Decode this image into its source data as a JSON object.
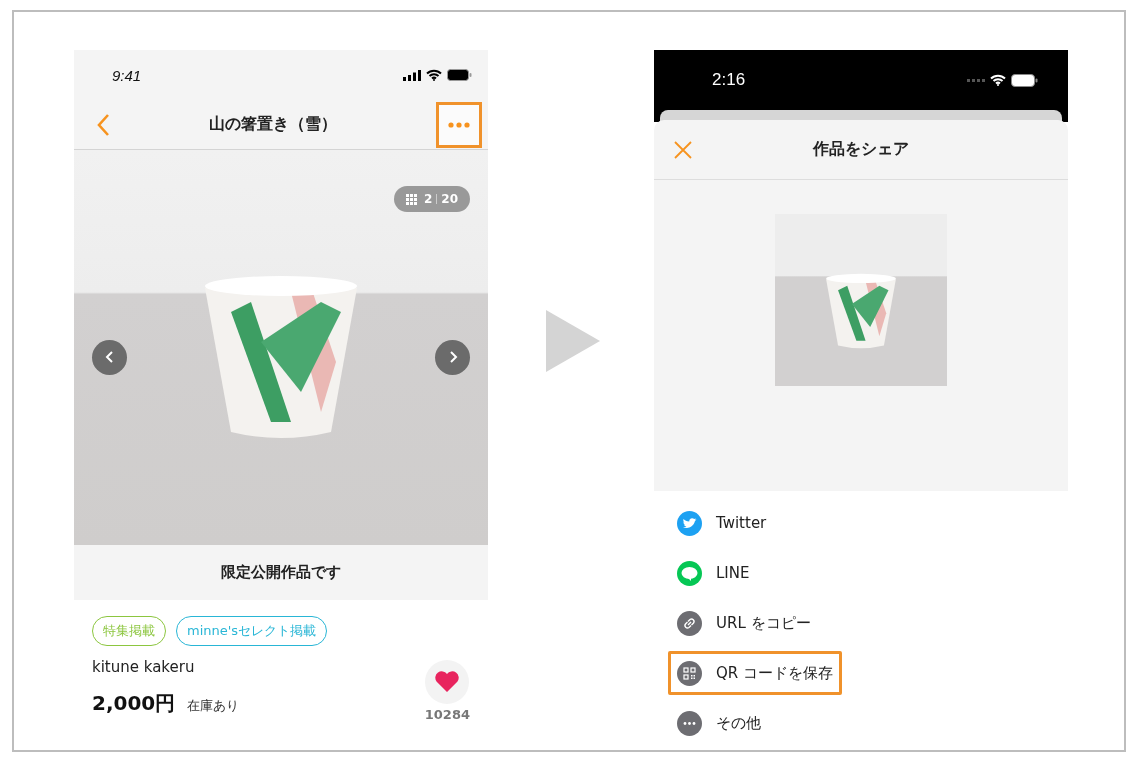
{
  "left_screen": {
    "status_bar": {
      "time": "9:41"
    },
    "nav": {
      "title": "山の箸置き（雪）",
      "more_highlighted": true
    },
    "photo": {
      "counter_current": "2",
      "counter_total": "20"
    },
    "notice": "限定公開作品です",
    "tags": [
      {
        "label": "特集掲載",
        "color": "#8cc63f"
      },
      {
        "label": "minne'sセレクト掲載",
        "color": "#29b6d6"
      }
    ],
    "creator": "kitune kakeru",
    "price": "2,000円",
    "stock": "在庫あり",
    "like_count": "10284"
  },
  "right_screen": {
    "status_bar": {
      "time": "2:16"
    },
    "sheet": {
      "title": "作品をシェア"
    },
    "share_items": [
      {
        "kind": "twitter",
        "label": "Twitter",
        "highlighted": false
      },
      {
        "kind": "line",
        "label": "LINE",
        "highlighted": false
      },
      {
        "kind": "link",
        "label": "URL をコピー",
        "highlighted": false
      },
      {
        "kind": "qr",
        "label": "QR コードを保存",
        "highlighted": true
      },
      {
        "kind": "more",
        "label": "その他",
        "highlighted": false
      }
    ]
  }
}
